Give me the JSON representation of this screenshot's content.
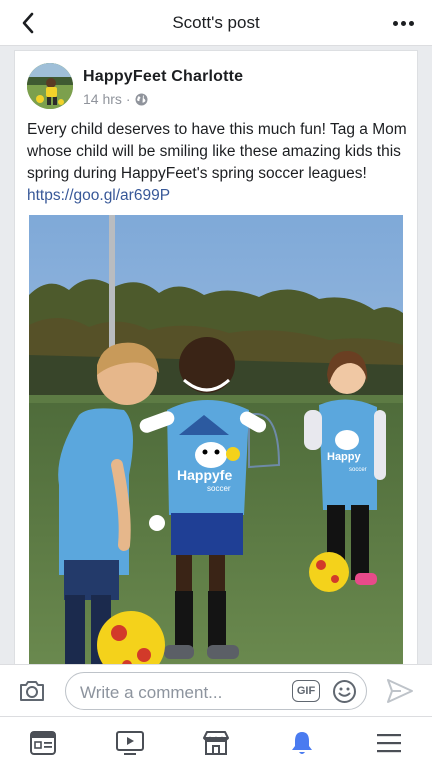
{
  "header": {
    "title": "Scott's post"
  },
  "post": {
    "author": "HappyFeet Charlotte",
    "time": "14 hrs",
    "separator": "·",
    "privacy_icon": "globe-icon",
    "text": "Every child deserves to have this much fun!  Tag a Mom whose child will be smiling like these amazing kids this spring during HappyFeet's spring soccer leagues! ",
    "link": "https://goo.gl/ar699P",
    "photo": {
      "jersey_text_left": "Happyfe",
      "jersey_text_left_sub": "soccer",
      "jersey_text_right": "Happy",
      "jersey_text_right_sub": "soccer"
    }
  },
  "comment_bar": {
    "placeholder": "Write a comment...",
    "gif_label": "GIF",
    "icons": [
      "camera-icon",
      "gif-icon",
      "emoji-icon",
      "send-icon"
    ]
  },
  "bottom_nav": {
    "items": [
      "news-feed-icon",
      "watch-icon",
      "marketplace-icon",
      "notifications-icon",
      "menu-icon"
    ],
    "active": "notifications-icon",
    "colors": {
      "active": "#4a7bf0",
      "inactive": "#4b4f56"
    }
  }
}
